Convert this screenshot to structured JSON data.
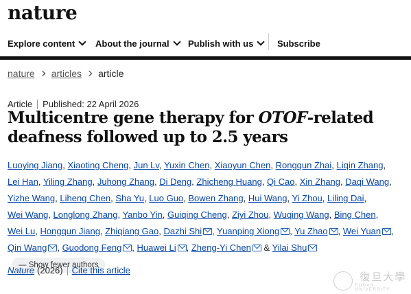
{
  "logo": "nature",
  "nav": {
    "items": [
      {
        "label": "Explore content"
      },
      {
        "label": "About the journal"
      },
      {
        "label": "Publish with us"
      }
    ],
    "subscribe": "Subscribe"
  },
  "breadcrumb": {
    "items": [
      "nature",
      "articles",
      "article"
    ]
  },
  "meta": {
    "type": "Article",
    "published": "Published: 22 April 2026"
  },
  "title": {
    "pre": "Multicentre gene therapy for ",
    "italic": "OTOF",
    "post": "-related deafness followed up to 2.5 years"
  },
  "authors": [
    "Luoying Jiang",
    "Xiaoting Cheng",
    "Jun Lv",
    "Yuxin Chen",
    "Xiaoyun Chen",
    "Rongqun Zhai",
    "Liqin Zhang",
    "Lei Han",
    "Yiling Zhang",
    "Juhong Zhang",
    "Di Deng",
    "Zhicheng Huang",
    "Qi Cao",
    "Xin Zhang",
    "Daqi Wang",
    "Yizhe Wang",
    "Liheng Chen",
    "Sha Yu",
    "Luo Guo",
    "Bowen Zhang",
    "Hui Wang",
    "Yi Zhou",
    "Liling Dai",
    "Wei Wang",
    "Longlong Zhang",
    "Yanbo Yin",
    "Guiqing Cheng",
    "Ziyi Zhou",
    "Wuqing Wang",
    "Bing Chen",
    "Wei Lu",
    "Hongqun Jiang",
    "Zhiqiang Gao",
    "Dazhi Shi",
    "Yuanping Xiong",
    "Yu Zhao",
    "Wei Yuan",
    "Qin Wang",
    "Guodong Feng",
    "Huawei Li",
    "Zheng-Yi Chen",
    "Yilai Shu"
  ],
  "corresponding_authors": [
    "Dazhi Shi",
    "Yuanping Xiong",
    "Yu Zhao",
    "Wei Yuan",
    "Qin Wang",
    "Guodong Feng",
    "Huawei Li",
    "Zheng-Yi Chen",
    "Yilai Shu"
  ],
  "ampersand": "&",
  "show_fewer_label": "— Show fewer authors",
  "citation": {
    "journal": "Nature",
    "year": "(2026)",
    "cite_label": "Cite this article"
  },
  "watermark": {
    "cn": "復旦大學",
    "en": "FUDAN UNIVERSITY"
  }
}
